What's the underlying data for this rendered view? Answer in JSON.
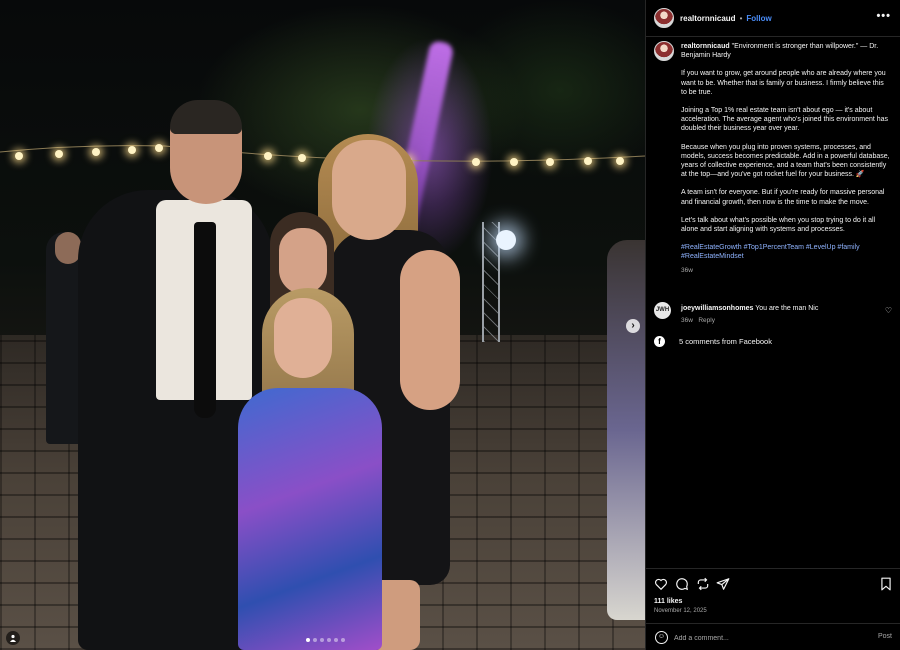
{
  "post": {
    "username": "realtornnicaud",
    "follow_label": "Follow",
    "separator": "•",
    "more_label": "•••",
    "caption": {
      "username": "realtornnicaud",
      "quote": "\"Environment is stronger than willpower.\" — Dr. Benjamin Hardy",
      "paragraphs": [
        "If you want to grow, get around people who are already where you want to be. Whether that is family or business. I firmly believe this to be true.",
        "Joining a Top 1% real estate team isn't about ego — it's about acceleration. The average agent who's joined this environment has doubled their business year over year.",
        "Because when you plug into proven systems, processes, and models, success becomes predictable. Add in a powerful database, years of collective experience, and a team that's been consistently at the top—and you've got rocket fuel for your business. 🚀",
        "A team isn't for everyone. But if you're ready for massive personal and financial growth, then now is the time to make the move.",
        "Let's talk about what's possible when you stop trying to do it all alone and start aligning with systems and processes."
      ],
      "hashtags": "#RealEstateGrowth #Top1PercentTeam #LevelUp #family #RealEstateMindset",
      "age": "36w"
    },
    "comment": {
      "avatar_text": "JWH",
      "username": "joeywilliamsonhomes",
      "text": "You are the man Nic",
      "age": "36w",
      "reply_label": "Reply"
    },
    "facebook_comments": "5 comments from Facebook",
    "likes": "111 likes",
    "date": "November 12, 2025",
    "add_comment_placeholder": "Add a comment...",
    "post_button": "Post"
  },
  "photo": {
    "carousel_count": 6,
    "carousel_active_index": 0
  },
  "icons": {
    "like": "heart-icon",
    "comment": "comment-bubble-icon",
    "share": "repost-icon",
    "send": "paper-plane-icon",
    "save": "bookmark-icon",
    "emoji": "smiley-icon",
    "facebook": "facebook-icon",
    "next": "chevron-right-icon",
    "tag": "person-tag-icon"
  },
  "colors": {
    "background": "#000000",
    "link_blue": "#4a8cf7",
    "hashtag": "#8fb3ff",
    "muted_text": "#a8a8a8"
  }
}
